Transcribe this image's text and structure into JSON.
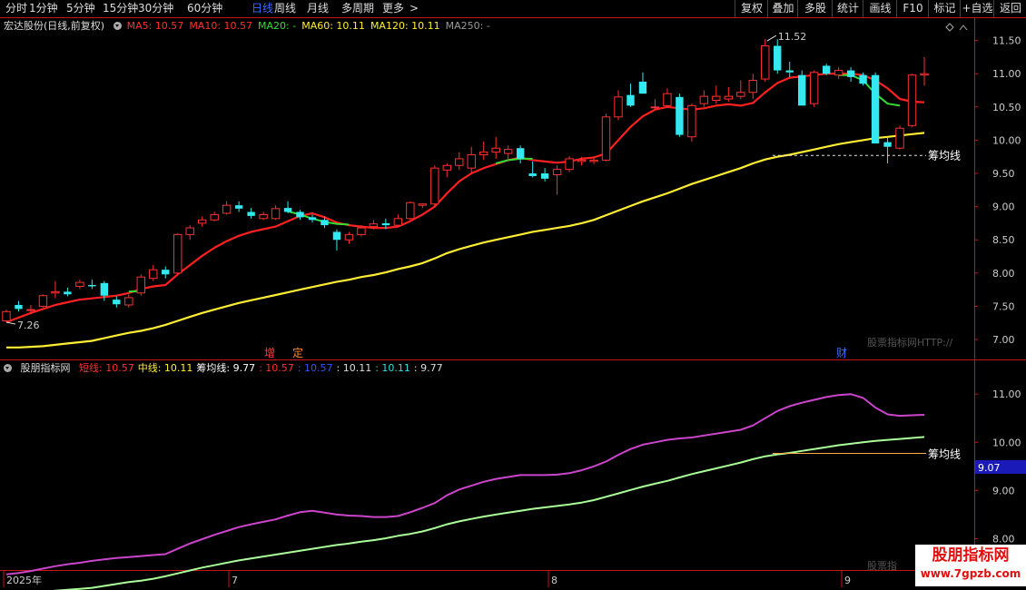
{
  "toolbar": {
    "periods": [
      {
        "label": "分时",
        "active": false
      },
      {
        "label": "1分钟",
        "active": false
      },
      {
        "label": "5分钟",
        "active": false
      },
      {
        "label": "15分钟",
        "active": false
      },
      {
        "label": "30分钟",
        "active": false
      },
      {
        "label": "60分钟",
        "active": false
      },
      {
        "label": "日线",
        "active": true
      },
      {
        "label": "周线",
        "active": false
      },
      {
        "label": "月线",
        "active": false
      },
      {
        "label": "多周期",
        "active": false
      },
      {
        "label": "更多",
        "active": false
      }
    ],
    "buttons": [
      "复权",
      "叠加",
      "多股",
      "统计",
      "画线",
      "F10",
      "标记",
      "+自选",
      "返回"
    ]
  },
  "main_info": {
    "title": "宏达股份(日线,前复权)",
    "ma": [
      {
        "label": "MA5: 10.57",
        "color": "#ff3030"
      },
      {
        "label": "MA10: 10.57",
        "color": "#ff3030"
      },
      {
        "label": "MA20: -",
        "color": "#33dd33"
      },
      {
        "label": "MA60: 10.11",
        "color": "#ffee33"
      },
      {
        "label": "MA120: 10.11",
        "color": "#ffee33"
      },
      {
        "label": "MA250: -",
        "color": "#999999"
      }
    ]
  },
  "sub_info": {
    "title": "股朋指标网",
    "items": [
      {
        "label": "短线: 10.57",
        "color": "#ff3030"
      },
      {
        "label": "中线: 10.11",
        "color": "#ffee33"
      },
      {
        "label": "筹均线: 9.77",
        "color": "#ffffff"
      },
      {
        "label": ": 10.57",
        "color": "#ff3030"
      },
      {
        "label": ": 10.57",
        "color": "#3355ff"
      },
      {
        "label": ": 10.11",
        "color": "#dddddd"
      },
      {
        "label": ": 10.11",
        "color": "#33dddd"
      },
      {
        "label": ": 9.77",
        "color": "#dddddd"
      }
    ]
  },
  "annotations": {
    "high": "11.52",
    "low": "7.26",
    "chou_main": "筹均线",
    "chou_sub": "筹均线",
    "sub_marker": "9.07",
    "watermark_main": "股票指标网HTTP://",
    "watermark_sub": "股票指",
    "events": [
      "增",
      "定",
      "财"
    ]
  },
  "logo": {
    "line1": "股朋指标网",
    "line2": "www.7gpzb.com"
  },
  "x_axis": {
    "labels": [
      "2025年",
      "7",
      "8",
      "9"
    ]
  },
  "colors": {
    "up": "#ff3030",
    "down": "#33e8f0",
    "ma5": "#ff2020",
    "ma60": "#ffee33",
    "ma20": "#33dd33"
  },
  "chart_data": [
    {
      "type": "candlestick",
      "title": "宏达股份(日线,前复权)",
      "ylim": [
        6.7,
        11.85
      ],
      "y_ticks": [
        7.0,
        7.5,
        8.0,
        8.5,
        9.0,
        9.5,
        10.0,
        10.5,
        11.0,
        11.5
      ],
      "candles": [
        {
          "o": 7.28,
          "h": 7.45,
          "l": 7.26,
          "c": 7.42
        },
        {
          "o": 7.52,
          "h": 7.58,
          "l": 7.42,
          "c": 7.46
        },
        {
          "o": 7.45,
          "h": 7.52,
          "l": 7.38,
          "c": 7.45
        },
        {
          "o": 7.5,
          "h": 7.68,
          "l": 7.48,
          "c": 7.66
        },
        {
          "o": 7.7,
          "h": 7.88,
          "l": 7.62,
          "c": 7.72
        },
        {
          "o": 7.72,
          "h": 7.78,
          "l": 7.65,
          "c": 7.68
        },
        {
          "o": 7.8,
          "h": 7.9,
          "l": 7.76,
          "c": 7.86
        },
        {
          "o": 7.82,
          "h": 7.9,
          "l": 7.76,
          "c": 7.8
        },
        {
          "o": 7.85,
          "h": 7.88,
          "l": 7.58,
          "c": 7.66
        },
        {
          "o": 7.6,
          "h": 7.65,
          "l": 7.48,
          "c": 7.53
        },
        {
          "o": 7.52,
          "h": 7.68,
          "l": 7.48,
          "c": 7.63
        },
        {
          "o": 7.7,
          "h": 7.98,
          "l": 7.66,
          "c": 7.94
        },
        {
          "o": 7.92,
          "h": 8.12,
          "l": 7.88,
          "c": 8.05
        },
        {
          "o": 8.05,
          "h": 8.1,
          "l": 7.92,
          "c": 7.98
        },
        {
          "o": 8.0,
          "h": 8.6,
          "l": 7.98,
          "c": 8.58
        },
        {
          "o": 8.58,
          "h": 8.72,
          "l": 8.5,
          "c": 8.68
        },
        {
          "o": 8.75,
          "h": 8.85,
          "l": 8.7,
          "c": 8.8
        },
        {
          "o": 8.8,
          "h": 8.92,
          "l": 8.78,
          "c": 8.88
        },
        {
          "o": 8.9,
          "h": 9.08,
          "l": 8.88,
          "c": 9.02
        },
        {
          "o": 9.02,
          "h": 9.08,
          "l": 8.92,
          "c": 8.97
        },
        {
          "o": 8.92,
          "h": 8.98,
          "l": 8.82,
          "c": 8.86
        },
        {
          "o": 8.82,
          "h": 8.92,
          "l": 8.8,
          "c": 8.88
        },
        {
          "o": 8.82,
          "h": 9.02,
          "l": 8.8,
          "c": 8.97
        },
        {
          "o": 8.98,
          "h": 9.08,
          "l": 8.9,
          "c": 8.92
        },
        {
          "o": 8.92,
          "h": 8.95,
          "l": 8.8,
          "c": 8.84
        },
        {
          "o": 8.84,
          "h": 8.88,
          "l": 8.76,
          "c": 8.8
        },
        {
          "o": 8.8,
          "h": 8.85,
          "l": 8.68,
          "c": 8.72
        },
        {
          "o": 8.62,
          "h": 8.66,
          "l": 8.34,
          "c": 8.5
        },
        {
          "o": 8.5,
          "h": 8.62,
          "l": 8.44,
          "c": 8.58
        },
        {
          "o": 8.58,
          "h": 8.72,
          "l": 8.55,
          "c": 8.68
        },
        {
          "o": 8.7,
          "h": 8.8,
          "l": 8.66,
          "c": 8.74
        },
        {
          "o": 8.75,
          "h": 8.82,
          "l": 8.66,
          "c": 8.72
        },
        {
          "o": 8.72,
          "h": 8.88,
          "l": 8.7,
          "c": 8.82
        },
        {
          "o": 8.82,
          "h": 9.08,
          "l": 8.8,
          "c": 9.06
        },
        {
          "o": 9.02,
          "h": 9.05,
          "l": 8.98,
          "c": 9.04
        },
        {
          "o": 9.04,
          "h": 9.62,
          "l": 9.0,
          "c": 9.58
        },
        {
          "o": 9.55,
          "h": 9.65,
          "l": 9.44,
          "c": 9.62
        },
        {
          "o": 9.62,
          "h": 9.82,
          "l": 9.55,
          "c": 9.72
        },
        {
          "o": 9.58,
          "h": 9.9,
          "l": 9.5,
          "c": 9.78
        },
        {
          "o": 9.78,
          "h": 9.98,
          "l": 9.7,
          "c": 9.82
        },
        {
          "o": 9.82,
          "h": 10.05,
          "l": 9.72,
          "c": 9.88
        },
        {
          "o": 9.8,
          "h": 9.92,
          "l": 9.68,
          "c": 9.86
        },
        {
          "o": 9.88,
          "h": 9.92,
          "l": 9.65,
          "c": 9.72
        },
        {
          "o": 9.5,
          "h": 9.68,
          "l": 9.44,
          "c": 9.46
        },
        {
          "o": 9.5,
          "h": 9.58,
          "l": 9.38,
          "c": 9.42
        },
        {
          "o": 9.48,
          "h": 9.62,
          "l": 9.18,
          "c": 9.56
        },
        {
          "o": 9.56,
          "h": 9.76,
          "l": 9.52,
          "c": 9.72
        },
        {
          "o": 9.68,
          "h": 9.75,
          "l": 9.62,
          "c": 9.7
        },
        {
          "o": 9.68,
          "h": 9.74,
          "l": 9.64,
          "c": 9.7
        },
        {
          "o": 9.7,
          "h": 10.4,
          "l": 9.68,
          "c": 10.35
        },
        {
          "o": 10.35,
          "h": 10.75,
          "l": 10.3,
          "c": 10.65
        },
        {
          "o": 10.68,
          "h": 10.85,
          "l": 10.5,
          "c": 10.52
        },
        {
          "o": 10.88,
          "h": 11.02,
          "l": 10.7,
          "c": 10.7
        },
        {
          "o": 10.5,
          "h": 10.62,
          "l": 10.46,
          "c": 10.5
        },
        {
          "o": 10.52,
          "h": 10.78,
          "l": 10.48,
          "c": 10.7
        },
        {
          "o": 10.65,
          "h": 10.7,
          "l": 10.05,
          "c": 10.08
        },
        {
          "o": 10.05,
          "h": 10.55,
          "l": 9.98,
          "c": 10.52
        },
        {
          "o": 10.55,
          "h": 10.75,
          "l": 10.5,
          "c": 10.66
        },
        {
          "o": 10.6,
          "h": 10.82,
          "l": 10.55,
          "c": 10.66
        },
        {
          "o": 10.62,
          "h": 10.8,
          "l": 10.58,
          "c": 10.66
        },
        {
          "o": 10.66,
          "h": 10.9,
          "l": 10.62,
          "c": 10.72
        },
        {
          "o": 10.72,
          "h": 11.0,
          "l": 10.62,
          "c": 10.9
        },
        {
          "o": 10.92,
          "h": 11.52,
          "l": 10.88,
          "c": 11.42
        },
        {
          "o": 11.42,
          "h": 11.52,
          "l": 11.0,
          "c": 11.05
        },
        {
          "o": 11.05,
          "h": 11.18,
          "l": 10.95,
          "c": 11.02
        },
        {
          "o": 10.98,
          "h": 11.05,
          "l": 10.62,
          "c": 10.52
        },
        {
          "o": 10.55,
          "h": 11.05,
          "l": 10.5,
          "c": 11.02
        },
        {
          "o": 11.12,
          "h": 11.15,
          "l": 10.98,
          "c": 11.0
        },
        {
          "o": 10.98,
          "h": 11.1,
          "l": 10.92,
          "c": 11.05
        },
        {
          "o": 11.05,
          "h": 11.1,
          "l": 10.88,
          "c": 10.95
        },
        {
          "o": 10.98,
          "h": 11.02,
          "l": 10.82,
          "c": 10.85
        },
        {
          "o": 10.98,
          "h": 11.02,
          "l": 9.95,
          "c": 9.95
        },
        {
          "o": 9.97,
          "h": 10.05,
          "l": 9.65,
          "c": 9.9
        },
        {
          "o": 9.88,
          "h": 10.22,
          "l": 9.86,
          "c": 10.18
        },
        {
          "o": 10.22,
          "h": 11.0,
          "l": 10.2,
          "c": 10.98
        },
        {
          "o": 10.98,
          "h": 11.25,
          "l": 10.82,
          "c": 11.0
        }
      ],
      "series": [
        {
          "name": "MA5",
          "color": "#ff2020",
          "values": [
            7.26,
            7.33,
            7.4,
            7.46,
            7.52,
            7.56,
            7.6,
            7.62,
            7.64,
            7.66,
            7.7,
            7.76,
            7.8,
            7.82,
            7.98,
            8.12,
            8.26,
            8.38,
            8.48,
            8.56,
            8.62,
            8.66,
            8.7,
            8.78,
            8.86,
            8.9,
            8.84,
            8.76,
            8.72,
            8.7,
            8.68,
            8.68,
            8.7,
            8.78,
            8.88,
            9.0,
            9.2,
            9.38,
            9.5,
            9.58,
            9.64,
            9.7,
            9.74,
            9.7,
            9.68,
            9.66,
            9.68,
            9.72,
            9.74,
            9.8,
            10.0,
            10.2,
            10.36,
            10.46,
            10.5,
            10.48,
            10.46,
            10.48,
            10.52,
            10.54,
            10.52,
            10.56,
            10.72,
            10.86,
            10.94,
            10.96,
            10.98,
            11.0,
            11.0,
            11.0,
            10.98,
            10.9,
            10.78,
            10.62,
            10.58,
            10.57
          ]
        },
        {
          "name": "MA60",
          "color": "#ffee33",
          "values": [
            6.88,
            6.88,
            6.89,
            6.9,
            6.92,
            6.94,
            6.96,
            6.98,
            7.02,
            7.06,
            7.1,
            7.13,
            7.17,
            7.22,
            7.28,
            7.34,
            7.4,
            7.45,
            7.5,
            7.55,
            7.59,
            7.63,
            7.67,
            7.71,
            7.75,
            7.79,
            7.83,
            7.87,
            7.9,
            7.94,
            7.97,
            8.01,
            8.06,
            8.1,
            8.15,
            8.22,
            8.3,
            8.36,
            8.41,
            8.46,
            8.5,
            8.54,
            8.58,
            8.62,
            8.65,
            8.68,
            8.71,
            8.75,
            8.8,
            8.87,
            8.94,
            9.01,
            9.08,
            9.14,
            9.2,
            9.27,
            9.34,
            9.4,
            9.46,
            9.52,
            9.58,
            9.65,
            9.71,
            9.75,
            9.78,
            9.82,
            9.86,
            9.9,
            9.94,
            9.97,
            10.0,
            10.03,
            10.05,
            10.07,
            10.09,
            10.11
          ]
        },
        {
          "name": "MA20",
          "color": "#33dd33",
          "values": [
            null,
            null,
            null,
            null,
            null,
            null,
            null,
            null,
            null,
            null,
            7.72,
            7.73,
            null,
            null,
            null,
            null,
            null,
            null,
            null,
            null,
            null,
            null,
            null,
            8.93,
            8.88,
            8.82,
            8.77,
            8.74,
            8.73,
            null,
            null,
            null,
            null,
            null,
            null,
            null,
            null,
            null,
            null,
            null,
            9.65,
            9.7,
            9.72,
            9.72,
            null,
            null,
            null,
            null,
            null,
            null,
            null,
            null,
            null,
            null,
            null,
            null,
            null,
            null,
            null,
            null,
            null,
            null,
            null,
            null,
            null,
            null,
            null,
            null,
            10.98,
            10.98,
            10.9,
            10.7,
            10.55,
            10.52,
            null,
            null
          ]
        }
      ],
      "chou_jun_xian": 9.77
    },
    {
      "type": "line",
      "title": "股朋指标网",
      "ylim": [
        7.35,
        11.7
      ],
      "y_ticks": [
        8.0,
        9.0,
        10.0,
        11.0
      ],
      "series": [
        {
          "name": "短线",
          "color": "#cc44cc",
          "values": [
            7.26,
            7.29,
            7.33,
            7.38,
            7.43,
            7.47,
            7.5,
            7.54,
            7.57,
            7.6,
            7.62,
            7.64,
            7.66,
            7.68,
            7.79,
            7.9,
            7.99,
            8.08,
            8.16,
            8.24,
            8.3,
            8.35,
            8.4,
            8.48,
            8.55,
            8.58,
            8.54,
            8.5,
            8.48,
            8.47,
            8.45,
            8.45,
            8.47,
            8.55,
            8.64,
            8.74,
            8.9,
            9.02,
            9.1,
            9.18,
            9.24,
            9.28,
            9.32,
            9.32,
            9.32,
            9.33,
            9.36,
            9.42,
            9.5,
            9.6,
            9.74,
            9.86,
            9.95,
            10.0,
            10.05,
            10.08,
            10.1,
            10.14,
            10.18,
            10.22,
            10.26,
            10.35,
            10.5,
            10.65,
            10.75,
            10.82,
            10.88,
            10.94,
            10.98,
            11.0,
            10.92,
            10.72,
            10.58,
            10.55,
            10.56,
            10.57
          ]
        },
        {
          "name": "中线",
          "color": "#aaff99",
          "values": [
            6.88,
            6.88,
            6.89,
            6.9,
            6.92,
            6.94,
            6.96,
            6.98,
            7.02,
            7.06,
            7.1,
            7.13,
            7.17,
            7.22,
            7.28,
            7.34,
            7.4,
            7.45,
            7.5,
            7.55,
            7.59,
            7.63,
            7.67,
            7.71,
            7.75,
            7.79,
            7.83,
            7.87,
            7.9,
            7.94,
            7.97,
            8.01,
            8.06,
            8.1,
            8.15,
            8.22,
            8.3,
            8.36,
            8.41,
            8.46,
            8.5,
            8.54,
            8.58,
            8.62,
            8.65,
            8.68,
            8.71,
            8.75,
            8.8,
            8.87,
            8.94,
            9.01,
            9.08,
            9.14,
            9.2,
            9.27,
            9.34,
            9.4,
            9.46,
            9.52,
            9.58,
            9.65,
            9.71,
            9.75,
            9.78,
            9.82,
            9.86,
            9.9,
            9.94,
            9.97,
            10.0,
            10.03,
            10.05,
            10.07,
            10.09,
            10.11
          ]
        },
        {
          "name": "筹均线",
          "color": "#ffffff",
          "values": [
            9.77
          ]
        }
      ]
    }
  ]
}
